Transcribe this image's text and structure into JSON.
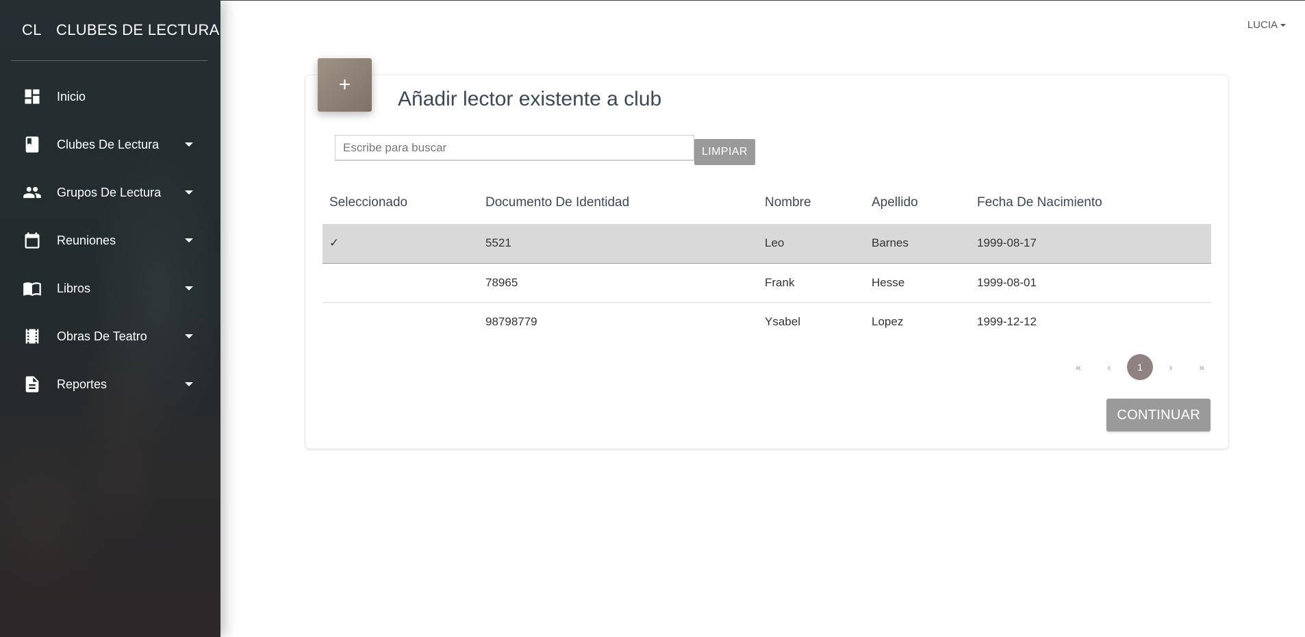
{
  "brand": {
    "mini": "CL",
    "name": "CLUBES DE LECTURA"
  },
  "sidebar": {
    "items": [
      {
        "label": "Inicio",
        "icon": "dashboard-icon",
        "has_dropdown": false
      },
      {
        "label": "Clubes De Lectura",
        "icon": "book-icon",
        "has_dropdown": true
      },
      {
        "label": "Grupos De Lectura",
        "icon": "people-icon",
        "has_dropdown": true
      },
      {
        "label": "Reuniones",
        "icon": "calendar-icon",
        "has_dropdown": true
      },
      {
        "label": "Libros",
        "icon": "open-book-icon",
        "has_dropdown": true
      },
      {
        "label": "Obras De Teatro",
        "icon": "theater-icon",
        "has_dropdown": true
      },
      {
        "label": "Reportes",
        "icon": "document-icon",
        "has_dropdown": true
      }
    ]
  },
  "user": {
    "name": "LUCIA"
  },
  "card": {
    "icon_symbol": "+",
    "title": "Añadir lector existente a club",
    "search": {
      "placeholder": "Escribe para buscar",
      "value": ""
    },
    "clear_label": "LIMPIAR",
    "table": {
      "headers": [
        "Seleccionado",
        "Documento De Identidad",
        "Nombre",
        "Apellido",
        "Fecha De Nacimiento"
      ],
      "rows": [
        {
          "selected": "✓",
          "documento": "5521",
          "nombre": "Leo",
          "apellido": "Barnes",
          "fecha": "1999-08-17"
        },
        {
          "selected": "",
          "documento": "78965",
          "nombre": "Frank",
          "apellido": "Hesse",
          "fecha": "1999-08-01"
        },
        {
          "selected": "",
          "documento": "98798779",
          "nombre": "Ysabel",
          "apellido": "Lopez",
          "fecha": "1999-12-12"
        }
      ]
    },
    "pagination": {
      "first": "«",
      "prev": "‹",
      "current": "1",
      "next": "›",
      "last": "»"
    },
    "continue_label": "CONTINUAR"
  },
  "colors": {
    "sidebar_bg": "#232d30",
    "accent": "#8f8281",
    "card_icon": "#8c8175",
    "button_gray": "#9a9a9a",
    "selected_row": "#d9d9d9"
  }
}
